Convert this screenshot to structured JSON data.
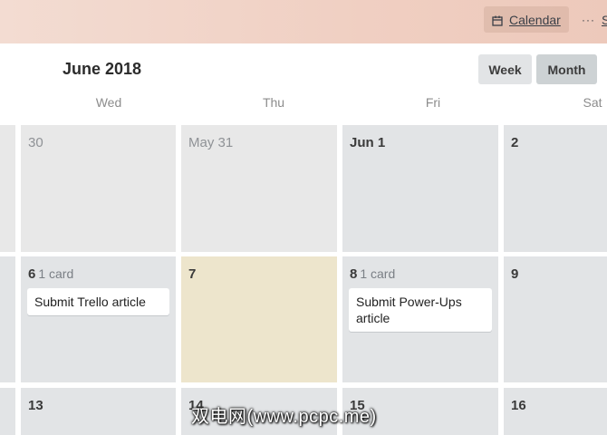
{
  "topbar": {
    "calendar_label": "Calendar",
    "more_dots": "···",
    "more_label": "S"
  },
  "header": {
    "month_title": "June 2018",
    "week_label": "Week",
    "month_label": "Month"
  },
  "days_of_week": [
    "Wed",
    "Thu",
    "Fri",
    "Sat"
  ],
  "weeks": [
    {
      "days": [
        {
          "num": "30"
        },
        {
          "num": "May 31"
        },
        {
          "num": "Jun 1"
        },
        {
          "num": "2"
        }
      ]
    },
    {
      "days": [
        {
          "num": "6",
          "count": "1 card",
          "card": "Submit Trello article"
        },
        {
          "num": "7"
        },
        {
          "num": "8",
          "count": "1 card",
          "card": "Submit Power-Ups article"
        },
        {
          "num": "9"
        }
      ]
    },
    {
      "days": [
        {
          "num": "13"
        },
        {
          "num": "14"
        },
        {
          "num": "15"
        },
        {
          "num": "16"
        }
      ]
    }
  ],
  "watermark": "双电网(www.pcpc.me)"
}
